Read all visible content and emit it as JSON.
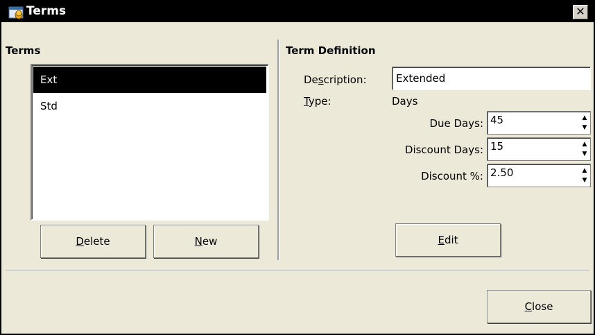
{
  "window": {
    "title": "Terms"
  },
  "left_panel": {
    "heading": "Terms",
    "items": [
      {
        "label": "Ext",
        "selected": true
      },
      {
        "label": "Std",
        "selected": false
      }
    ],
    "delete_button": {
      "mnemonic": "D",
      "rest": "elete"
    },
    "new_button": {
      "mnemonic": "N",
      "rest": "ew"
    }
  },
  "right_panel": {
    "heading": "Term Definition",
    "description": {
      "label_pre": "De",
      "label_mn": "s",
      "label_post": "cription:",
      "value": "Extended"
    },
    "type": {
      "label_mn": "T",
      "label_post": "ype:",
      "value": "Days"
    },
    "due_days": {
      "label": "Due Days:",
      "value": "45"
    },
    "discount_days": {
      "label": "Discount Days:",
      "value": "15"
    },
    "discount_pct": {
      "label": "Discount %:",
      "value": "2.50"
    },
    "edit_button": {
      "mnemonic": "E",
      "rest": "dit"
    }
  },
  "footer": {
    "close_button": {
      "mnemonic": "C",
      "rest": "lose"
    }
  },
  "colors": {
    "selection": "#000000",
    "window_bg": "#ece9d8",
    "titlebar": "#000000"
  }
}
